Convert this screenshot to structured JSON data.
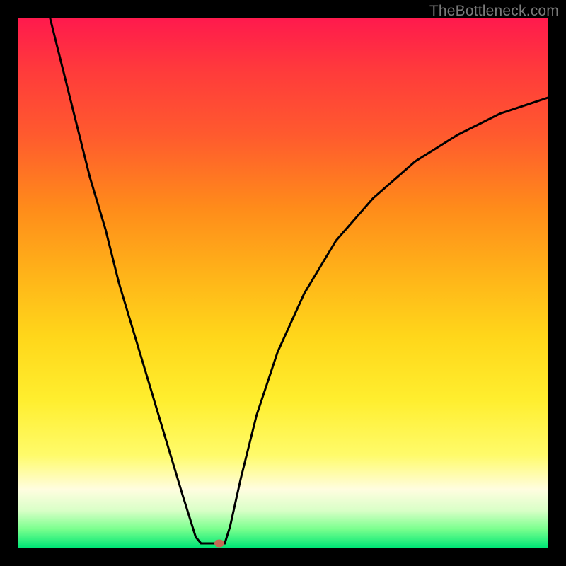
{
  "attribution": "TheBottleneck.com",
  "colors": {
    "frame": "#000000",
    "gradient_top": "#ff1a4d",
    "gradient_bottom": "#00e676",
    "marker": "#c46a55",
    "curve": "#000000"
  },
  "chart_data": {
    "type": "line",
    "title": "",
    "xlabel": "",
    "ylabel": "",
    "xlim": [
      0,
      100
    ],
    "ylim": [
      0,
      100
    ],
    "left_branch": [
      {
        "x": 6.0,
        "y": 100.0
      },
      {
        "x": 8.5,
        "y": 90.0
      },
      {
        "x": 11.0,
        "y": 80.0
      },
      {
        "x": 13.5,
        "y": 70.0
      },
      {
        "x": 16.5,
        "y": 60.0
      },
      {
        "x": 19.0,
        "y": 50.0
      },
      {
        "x": 22.0,
        "y": 40.0
      },
      {
        "x": 25.0,
        "y": 30.0
      },
      {
        "x": 28.0,
        "y": 20.0
      },
      {
        "x": 31.0,
        "y": 10.0
      },
      {
        "x": 33.5,
        "y": 2.0
      },
      {
        "x": 34.5,
        "y": 0.8
      }
    ],
    "right_branch": [
      {
        "x": 39.0,
        "y": 0.8
      },
      {
        "x": 40.0,
        "y": 4.0
      },
      {
        "x": 42.0,
        "y": 13.0
      },
      {
        "x": 45.0,
        "y": 25.0
      },
      {
        "x": 49.0,
        "y": 37.0
      },
      {
        "x": 54.0,
        "y": 48.0
      },
      {
        "x": 60.0,
        "y": 58.0
      },
      {
        "x": 67.0,
        "y": 66.0
      },
      {
        "x": 75.0,
        "y": 73.0
      },
      {
        "x": 83.0,
        "y": 78.0
      },
      {
        "x": 91.0,
        "y": 82.0
      },
      {
        "x": 100.0,
        "y": 85.0
      }
    ],
    "marker": {
      "x": 38.0,
      "y": 0.8
    }
  }
}
